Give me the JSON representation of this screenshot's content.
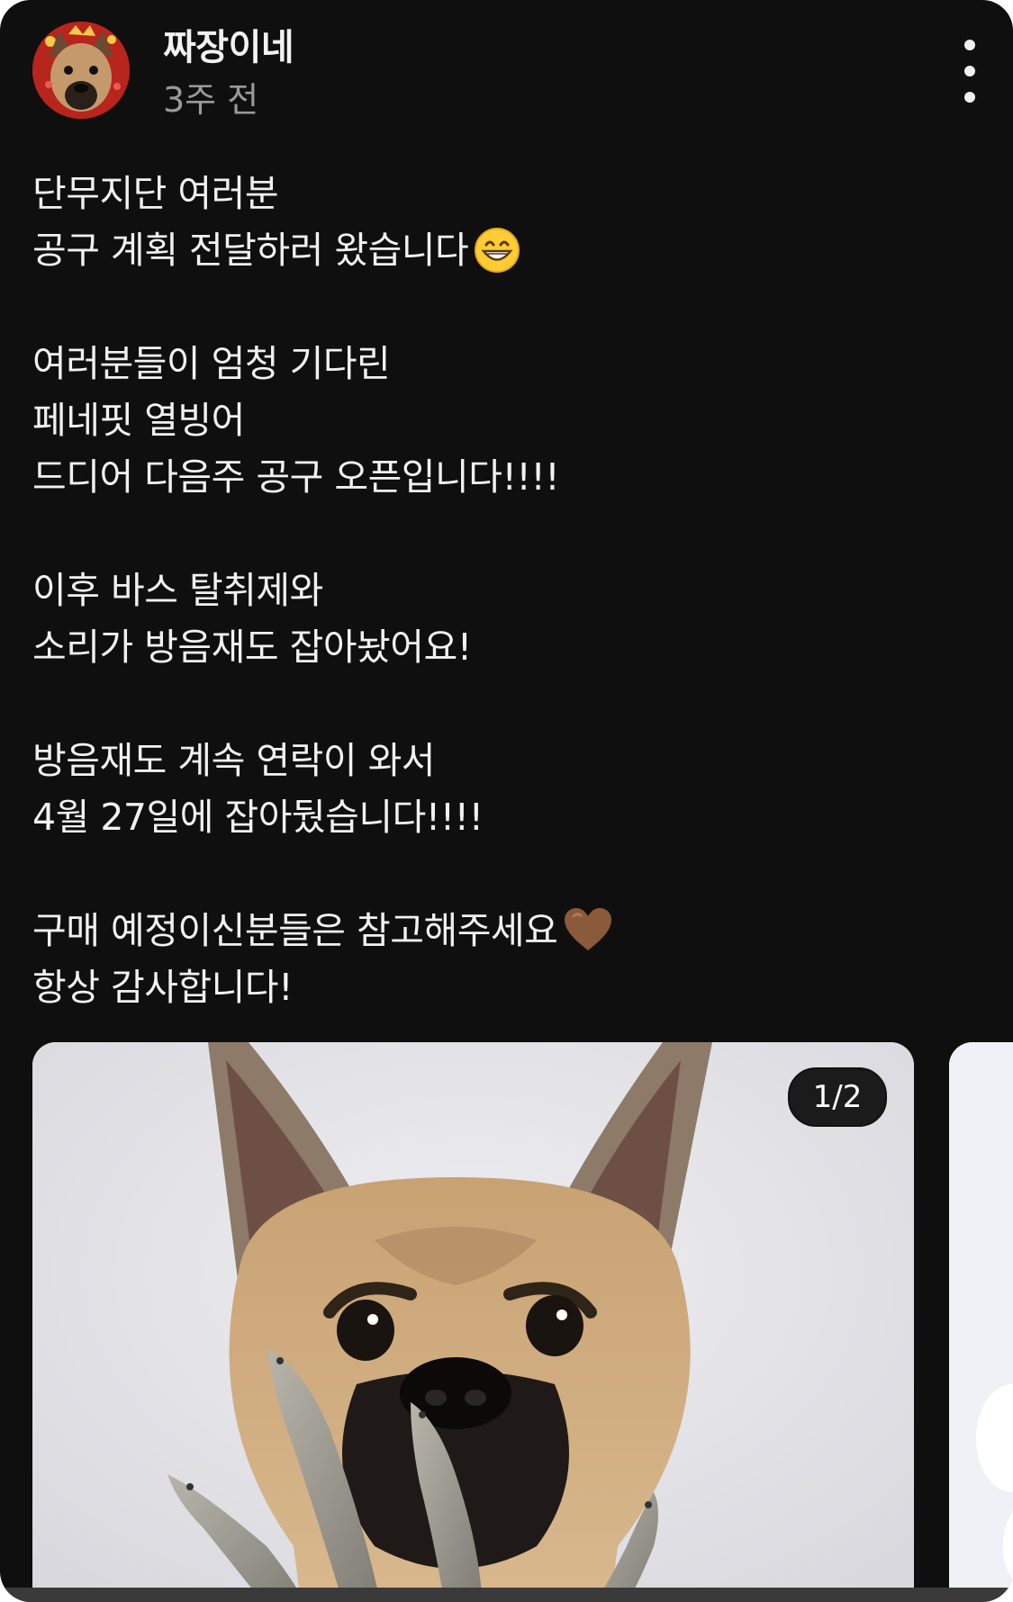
{
  "post": {
    "author": "짜장이네",
    "time_ago": "3주 전",
    "more_icon": "more-vertical-icon",
    "text_paragraphs": [
      {
        "lines": [
          "단무지단 여러분",
          "공구 계획 전달하러 왔습니다"
        ]
      },
      {
        "lines": [
          "여러분들이 엄청 기다린",
          "페네핏 열빙어",
          "드디어 다음주 공구 오픈입니다!!!!"
        ]
      },
      {
        "lines": [
          "이후 바스 탈취제와",
          "소리가 방음재도 잡아놨어요!"
        ]
      },
      {
        "lines": [
          "방음재도 계속 연락이 와서",
          "4월 27일에 잡아뒀습니다!!!!"
        ]
      },
      {
        "lines": [
          "구매 예정이신분들은 참고해주세요",
          "항상 감사합니다!"
        ]
      }
    ],
    "emojis": {
      "grin": "grinning-face-emoji",
      "heart": "brown-heart-emoji"
    },
    "media": {
      "counter": "1/2",
      "image": "dog-with-dried-fish-photo",
      "current_index": 1,
      "total": 2
    }
  },
  "colors": {
    "background": "#0f0f0f",
    "text": "#f1f1f1",
    "muted": "#9a9a9a",
    "heart": "#8a5a3a"
  }
}
